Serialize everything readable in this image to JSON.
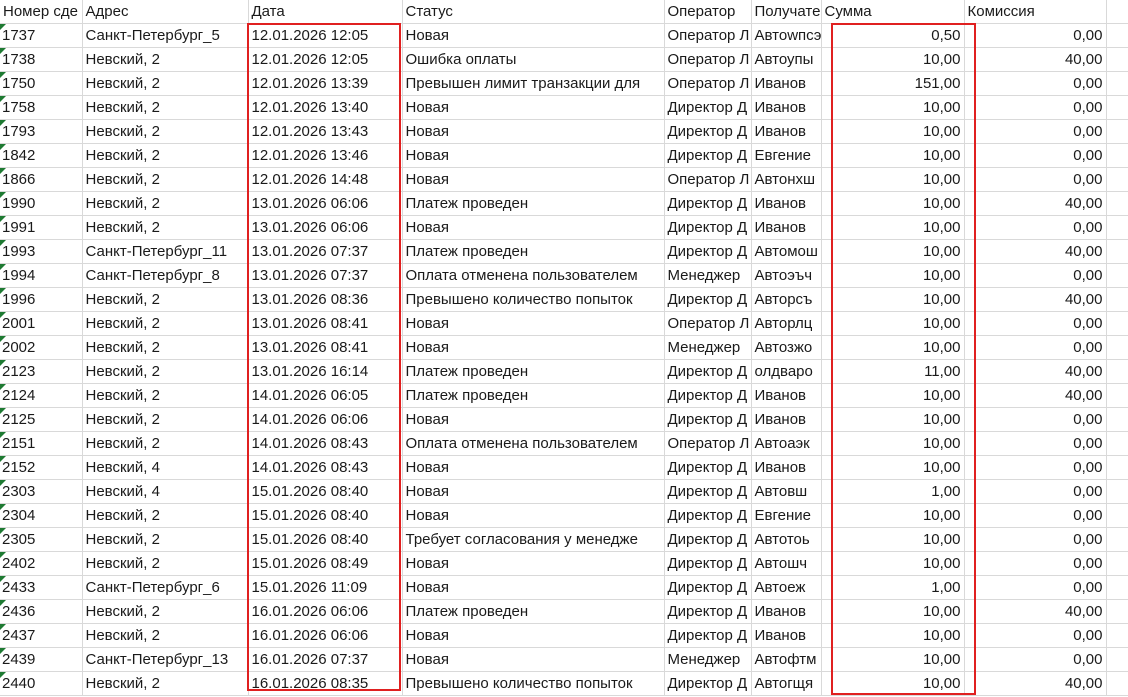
{
  "columns": [
    "Номер сде",
    "Адрес",
    "Дата",
    "Статус",
    "Оператор",
    "Получате",
    "Сумма",
    "Комиссия"
  ],
  "highlight_color": "#e02020",
  "rows": [
    [
      "1737",
      "Санкт-Петербург_5",
      "12.01.2026 12:05",
      "Новая",
      "Оператор Л",
      "Автоwпсэ",
      "0,50",
      "0,00"
    ],
    [
      "1738",
      "Невский, 2",
      "12.01.2026 12:05",
      "Ошибка оплаты",
      "Оператор Л",
      "Автоупы",
      "10,00",
      "40,00"
    ],
    [
      "1750",
      "Невский, 2",
      "12.01.2026 13:39",
      "Превышен лимит транзакции для",
      "Оператор Л",
      "Иванов",
      "151,00",
      "0,00"
    ],
    [
      "1758",
      "Невский, 2",
      "12.01.2026 13:40",
      "Новая",
      "Директор Д",
      "Иванов",
      "10,00",
      "0,00"
    ],
    [
      "1793",
      "Невский, 2",
      "12.01.2026 13:43",
      "Новая",
      "Директор Д",
      "Иванов",
      "10,00",
      "0,00"
    ],
    [
      "1842",
      "Невский, 2",
      "12.01.2026 13:46",
      "Новая",
      "Директор Д",
      "Евгение",
      "10,00",
      "0,00"
    ],
    [
      "1866",
      "Невский, 2",
      "12.01.2026 14:48",
      "Новая",
      "Оператор Л",
      "Автонхш",
      "10,00",
      "0,00"
    ],
    [
      "1990",
      "Невский, 2",
      "13.01.2026 06:06",
      "Платеж проведен",
      "Директор Д",
      "Иванов",
      "10,00",
      "40,00"
    ],
    [
      "1991",
      "Невский, 2",
      "13.01.2026 06:06",
      "Новая",
      "Директор Д",
      "Иванов",
      "10,00",
      "0,00"
    ],
    [
      "1993",
      "Санкт-Петербург_11",
      "13.01.2026 07:37",
      "Платеж проведен",
      "Директор Д",
      "Автомош",
      "10,00",
      "40,00"
    ],
    [
      "1994",
      "Санкт-Петербург_8",
      "13.01.2026 07:37",
      "Оплата отменена пользователем",
      "Менеджер",
      "Автоэъч",
      "10,00",
      "0,00"
    ],
    [
      "1996",
      "Невский, 2",
      "13.01.2026 08:36",
      "Превышено количество попыток",
      "Директор Д",
      "Авторсъ",
      "10,00",
      "40,00"
    ],
    [
      "2001",
      "Невский, 2",
      "13.01.2026 08:41",
      "Новая",
      "Оператор Л",
      "Авторлц",
      "10,00",
      "0,00"
    ],
    [
      "2002",
      "Невский, 2",
      "13.01.2026 08:41",
      "Новая",
      "Менеджер",
      "Автозжо",
      "10,00",
      "0,00"
    ],
    [
      "2123",
      "Невский, 2",
      "13.01.2026 16:14",
      "Платеж проведен",
      "Директор Д",
      "олдваро",
      "11,00",
      "40,00"
    ],
    [
      "2124",
      "Невский, 2",
      "14.01.2026 06:05",
      "Платеж проведен",
      "Директор Д",
      "Иванов",
      "10,00",
      "40,00"
    ],
    [
      "2125",
      "Невский, 2",
      "14.01.2026 06:06",
      "Новая",
      "Директор Д",
      "Иванов",
      "10,00",
      "0,00"
    ],
    [
      "2151",
      "Невский, 2",
      "14.01.2026 08:43",
      "Оплата отменена пользователем",
      "Оператор Л",
      "Автоаэк",
      "10,00",
      "0,00"
    ],
    [
      "2152",
      "Невский, 4",
      "14.01.2026 08:43",
      "Новая",
      "Директор Д",
      "Иванов",
      "10,00",
      "0,00"
    ],
    [
      "2303",
      "Невский, 4",
      "15.01.2026 08:40",
      "Новая",
      "Директор Д",
      "Автовш",
      "1,00",
      "0,00"
    ],
    [
      "2304",
      "Невский, 2",
      "15.01.2026 08:40",
      "Новая",
      "Директор Д",
      "Евгение",
      "10,00",
      "0,00"
    ],
    [
      "2305",
      "Невский, 2",
      "15.01.2026 08:40",
      "Требует согласования у менедже",
      "Директор Д",
      "Автотоь",
      "10,00",
      "0,00"
    ],
    [
      "2402",
      "Невский, 2",
      "15.01.2026 08:49",
      "Новая",
      "Директор Д",
      "Автошч",
      "10,00",
      "0,00"
    ],
    [
      "2433",
      "Санкт-Петербург_6",
      "15.01.2026 11:09",
      "Новая",
      "Директор Д",
      "Автоеж",
      "1,00",
      "0,00"
    ],
    [
      "2436",
      "Невский, 2",
      "16.01.2026 06:06",
      "Платеж проведен",
      "Директор Д",
      "Иванов",
      "10,00",
      "40,00"
    ],
    [
      "2437",
      "Невский, 2",
      "16.01.2026 06:06",
      "Новая",
      "Директор Д",
      "Иванов",
      "10,00",
      "0,00"
    ],
    [
      "2439",
      "Санкт-Петербург_13",
      "16.01.2026 07:37",
      "Новая",
      "Менеджер",
      "Автофтм",
      "10,00",
      "0,00"
    ],
    [
      "2440",
      "Невский, 2",
      "16.01.2026 08:35",
      "Превышено количество попыток",
      "Директор Д",
      "Автогщя",
      "10,00",
      "40,00"
    ]
  ]
}
